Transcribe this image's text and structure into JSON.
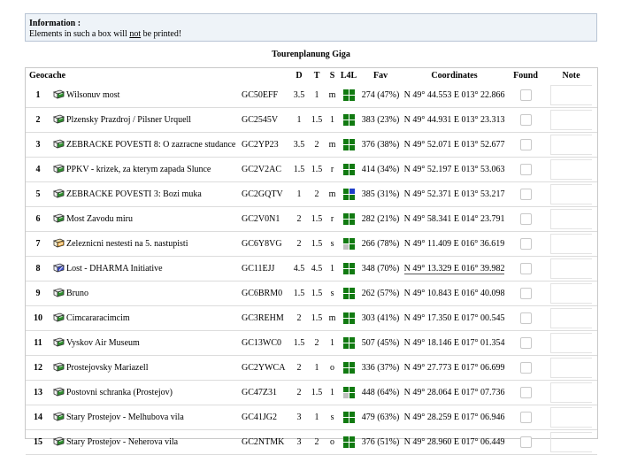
{
  "info": {
    "title": "Information :",
    "pre": "Elements in such a box will ",
    "underlined": "not",
    "post": " be printed!"
  },
  "page_title": "Tourenplanung Giga",
  "colors": {
    "found_green": "#117a11",
    "blue": "#1e3ec8",
    "grey": "#c0c0c0"
  },
  "headers": {
    "geocache": "Geocache",
    "d": "D",
    "t": "T",
    "s": "S",
    "l4l": "L4L",
    "fav": "Fav",
    "coords": "Coordinates",
    "found": "Found",
    "note": "Note"
  },
  "rows": [
    {
      "num": "1",
      "type": "traditional-cache-icon",
      "name": "Wilsonuv most",
      "code": "GC50EFF",
      "d": "3.5",
      "t": "1",
      "s": "m",
      "l4l": [
        "g",
        "g",
        "g",
        "g"
      ],
      "fav": "274 (47%)",
      "coords": "N 49° 44.553 E 013° 22.866",
      "hl": false
    },
    {
      "num": "2",
      "type": "traditional-cache-icon",
      "name": "Plzensky Prazdroj / Pilsner Urquell",
      "code": "GC2545V",
      "d": "1",
      "t": "1.5",
      "s": "1",
      "l4l": [
        "g",
        "g",
        "g",
        "g"
      ],
      "fav": "383 (23%)",
      "coords": "N 49° 44.931 E 013° 23.313",
      "hl": false
    },
    {
      "num": "3",
      "type": "traditional-cache-icon",
      "name": "ZEBRACKE POVESTI 8: O zazracne studance",
      "code": "GC2YP23",
      "d": "3.5",
      "t": "2",
      "s": "m",
      "l4l": [
        "g",
        "g",
        "g",
        "g"
      ],
      "fav": "376 (38%)",
      "coords": "N 49° 52.071 E 013° 52.677",
      "hl": false
    },
    {
      "num": "4",
      "type": "traditional-cache-icon",
      "name": "PPKV - krizek, za kterym zapada Slunce",
      "code": "GC2V2AC",
      "d": "1.5",
      "t": "1.5",
      "s": "r",
      "l4l": [
        "g",
        "g",
        "g",
        "g"
      ],
      "fav": "414 (34%)",
      "coords": "N 49° 52.197 E 013° 53.063",
      "hl": false
    },
    {
      "num": "5",
      "type": "traditional-cache-icon",
      "name": "ZEBRACKE POVESTI 3: Bozi muka",
      "code": "GC2GQTV",
      "d": "1",
      "t": "2",
      "s": "m",
      "l4l": [
        "g",
        "b",
        "g",
        "g"
      ],
      "fav": "385 (31%)",
      "coords": "N 49° 52.371 E 013° 53.217",
      "hl": false
    },
    {
      "num": "6",
      "type": "traditional-cache-icon",
      "name": "Most Zavodu miru",
      "code": "GC2V0N1",
      "d": "2",
      "t": "1.5",
      "s": "r",
      "l4l": [
        "g",
        "g",
        "g",
        "g"
      ],
      "fav": "282 (21%)",
      "coords": "N 49° 58.341 E 014° 23.791",
      "hl": false
    },
    {
      "num": "7",
      "type": "multi-cache-icon",
      "name": "Zeleznicni nestesti na 5. nastupisti",
      "code": "GC6Y8VG",
      "d": "2",
      "t": "1.5",
      "s": "s",
      "l4l": [
        "g",
        "g",
        "x",
        "g"
      ],
      "fav": "266 (78%)",
      "coords": "N 49° 11.409 E 016° 36.619",
      "hl": false
    },
    {
      "num": "8",
      "type": "mystery-cache-icon",
      "name": "Lost - DHARMA Initiative",
      "code": "GC11EJJ",
      "d": "4.5",
      "t": "4.5",
      "s": "1",
      "l4l": [
        "g",
        "g",
        "g",
        "g"
      ],
      "fav": "348 (70%)",
      "coords": "N 49° 13.329 E 016° 39.982",
      "hl": true
    },
    {
      "num": "9",
      "type": "traditional-cache-icon",
      "name": "Bruno",
      "code": "GC6BRM0",
      "d": "1.5",
      "t": "1.5",
      "s": "s",
      "l4l": [
        "g",
        "g",
        "g",
        "g"
      ],
      "fav": "262 (57%)",
      "coords": "N 49° 10.843 E 016° 40.098",
      "hl": false
    },
    {
      "num": "10",
      "type": "traditional-cache-icon",
      "name": "Cimcararacimcim",
      "code": "GC3REHM",
      "d": "2",
      "t": "1.5",
      "s": "m",
      "l4l": [
        "g",
        "g",
        "g",
        "g"
      ],
      "fav": "303 (41%)",
      "coords": "N 49° 17.350 E 017° 00.545",
      "hl": false
    },
    {
      "num": "11",
      "type": "traditional-cache-icon",
      "name": "Vyskov Air Museum",
      "code": "GC13WC0",
      "d": "1.5",
      "t": "2",
      "s": "1",
      "l4l": [
        "g",
        "g",
        "g",
        "g"
      ],
      "fav": "507 (45%)",
      "coords": "N 49° 18.146 E 017° 01.354",
      "hl": false
    },
    {
      "num": "12",
      "type": "traditional-cache-icon",
      "name": "Prostejovsky Mariazell",
      "code": "GC2YWCA",
      "d": "2",
      "t": "1",
      "s": "o",
      "l4l": [
        "g",
        "g",
        "g",
        "g"
      ],
      "fav": "336 (37%)",
      "coords": "N 49° 27.773 E 017° 06.699",
      "hl": false
    },
    {
      "num": "13",
      "type": "traditional-cache-icon",
      "name": "Postovni schranka (Prostejov)",
      "code": "GC47Z31",
      "d": "2",
      "t": "1.5",
      "s": "1",
      "l4l": [
        "g",
        "g",
        "x",
        "g"
      ],
      "fav": "448 (64%)",
      "coords": "N 49° 28.064 E 017° 07.736",
      "hl": false
    },
    {
      "num": "14",
      "type": "traditional-cache-icon",
      "name": "Stary Prostejov - Melhubova vila",
      "code": "GC41JG2",
      "d": "3",
      "t": "1",
      "s": "s",
      "l4l": [
        "g",
        "g",
        "g",
        "g"
      ],
      "fav": "479 (63%)",
      "coords": "N 49° 28.259 E 017° 06.946",
      "hl": false
    },
    {
      "num": "15",
      "type": "traditional-cache-icon",
      "name": "Stary Prostejov - Neherova vila",
      "code": "GC2NTMK",
      "d": "3",
      "t": "2",
      "s": "o",
      "l4l": [
        "g",
        "g",
        "g",
        "g"
      ],
      "fav": "376 (51%)",
      "coords": "N 49° 28.960 E 017° 06.449",
      "hl": false
    }
  ]
}
